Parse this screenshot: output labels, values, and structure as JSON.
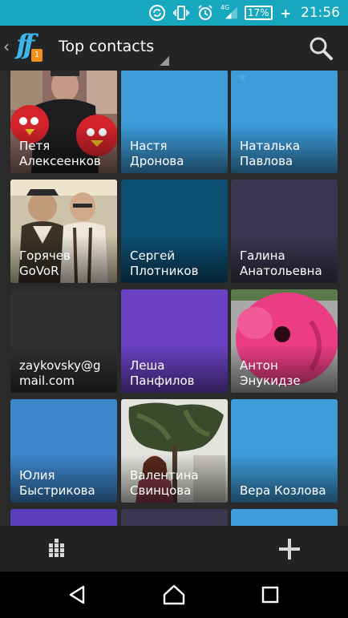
{
  "status_bar": {
    "network": "4G",
    "battery": "17%",
    "time": "21:56",
    "icons": [
      "sync-icon",
      "vibrate-icon",
      "alarm-icon",
      "signal-icon",
      "battery-icon",
      "charging-plus-icon"
    ]
  },
  "app_bar": {
    "logo_text": "ff",
    "badge_count": "1",
    "title": "Top contacts",
    "icons": [
      "back-chevron-icon",
      "dropdown-caret-icon",
      "search-icon"
    ]
  },
  "contacts": [
    {
      "name": "Петя\nАлексеенков",
      "color": "#7a2a1c",
      "photo": "person-angry-birds"
    },
    {
      "name": "Настя\nДронова",
      "color": "#3d9bd8"
    },
    {
      "name": "Наталька\nПавлова",
      "color": "#3d9bd8"
    },
    {
      "name": "Горячев\nGoVoR",
      "color": "#6b5a3e",
      "photo": "two-men"
    },
    {
      "name": "Сергей\nПлотников",
      "color": "#0d4f73"
    },
    {
      "name": "Галина\nАнатольевна",
      "color": "#3a3850"
    },
    {
      "name": "zaykovsky@g\nmail.com",
      "color": "#303030"
    },
    {
      "name": "Леша\nПанфилов",
      "color": "#6a42c3"
    },
    {
      "name": "Антон\nЭнукидзе",
      "color": "#e0407c",
      "photo": "pink-cartoon"
    },
    {
      "name": "Юлия\nБыстрикова",
      "color": "#3d86cc"
    },
    {
      "name": "Валентина\nСвинцова",
      "color": "#4a5a3a",
      "photo": "woman-under-tree"
    },
    {
      "name": "Вера Козлова",
      "color": "#3d9bd8"
    },
    {
      "name": "",
      "color": "#5b3fbf"
    },
    {
      "name": "",
      "color": "#3a3850"
    },
    {
      "name": "",
      "color": "#3d9bd8"
    }
  ],
  "bottom_bar": {
    "icons": [
      "dialpad-grid-icon",
      "add-contact-plus-icon"
    ]
  },
  "nav_bar": {
    "icons": [
      "back-triangle-icon",
      "home-icon",
      "recents-square-icon"
    ]
  },
  "colors": {
    "status_bar": "#17a8bf",
    "app_bar": "#222426",
    "bottom_bar": "#202224",
    "accent": "#3fb6e8",
    "badge": "#f0901a"
  }
}
